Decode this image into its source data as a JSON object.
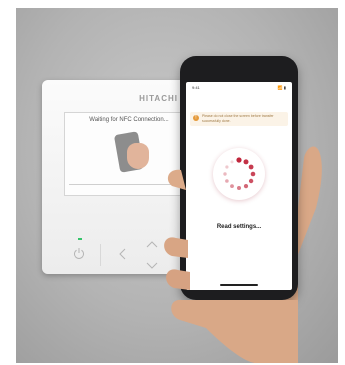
{
  "controller": {
    "brand": "HITACHI",
    "screen_text": "Waiting for NFC Connection..."
  },
  "phone": {
    "status_time": "9:41",
    "status_icons": "📶 ▮",
    "notice_text": "Please do not close the screen before transfer successfully done.",
    "status_label": "Read settings..."
  },
  "colors": {
    "accent": "#c0263c",
    "led": "#35c46a",
    "notice_bg": "#fbf3e7"
  },
  "icons": [
    "power-icon",
    "chevron-left-icon",
    "chevron-up-icon",
    "chevron-down-icon",
    "warning-icon",
    "loading-spinner-icon"
  ]
}
